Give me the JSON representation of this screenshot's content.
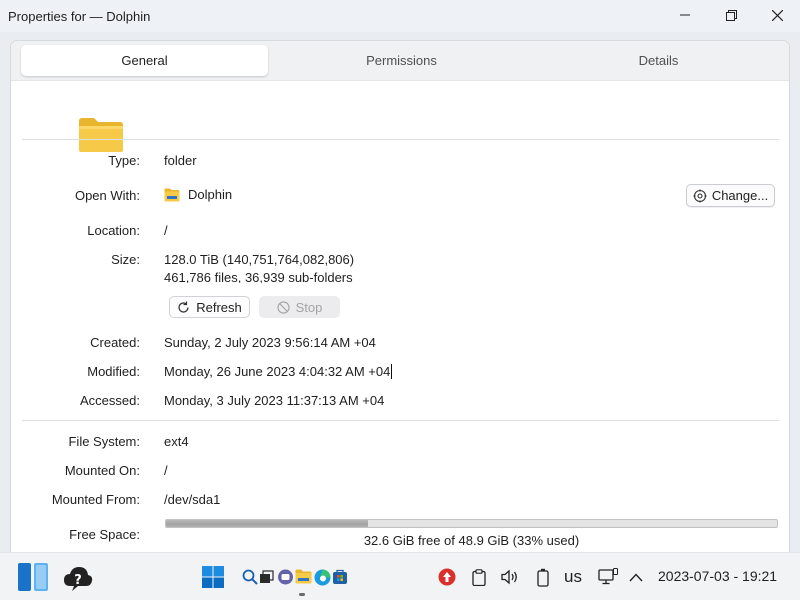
{
  "window": {
    "title": "Properties for — Dolphin"
  },
  "tabs": [
    {
      "label": "General"
    },
    {
      "label": "Permissions"
    },
    {
      "label": "Details"
    }
  ],
  "general": {
    "type": {
      "label": "Type:",
      "value": "folder"
    },
    "open_with": {
      "label": "Open With:",
      "app": "Dolphin",
      "change_label": "Change..."
    },
    "location": {
      "label": "Location:",
      "value": "/"
    },
    "size": {
      "label": "Size:",
      "line1": "128.0 TiB (140,751,764,082,806)",
      "line2": "461,786 files, 36,939 sub-folders",
      "refresh_label": "Refresh",
      "stop_label": "Stop"
    },
    "created": {
      "label": "Created:",
      "value": "Sunday, 2 July 2023 9:56:14 AM +04"
    },
    "modified": {
      "label": "Modified:",
      "value": "Monday, 26 June 2023 4:04:32 AM +04"
    },
    "accessed": {
      "label": "Accessed:",
      "value": "Monday, 3 July 2023 11:37:13 AM +04"
    },
    "file_system": {
      "label": "File System:",
      "value": "ext4"
    },
    "mounted_on": {
      "label": "Mounted On:",
      "value": "/"
    },
    "mounted_from": {
      "label": "Mounted From:",
      "value": "/dev/sda1"
    },
    "free_space": {
      "label": "Free Space:",
      "text": "32.6 GiB free of 48.9 GiB (33% used)",
      "used_fraction": 0.33
    }
  },
  "taskbar": {
    "icons": [
      "widgets-icon",
      "help-icon",
      "start-icon",
      "search-icon",
      "task-view-icon",
      "chat-icon",
      "file-manager-icon",
      "edge-icon",
      "store-icon",
      "update-icon",
      "clipboard-icon",
      "volume-icon",
      "battery-icon",
      "display-icon",
      "tray-expand-icon"
    ],
    "language": "us",
    "clock": "2023-07-03 - 19:21"
  },
  "colors": {
    "folder_yellow": "#f7c948",
    "update_red": "#d9302c",
    "windows_blue": "#0a78d4"
  }
}
